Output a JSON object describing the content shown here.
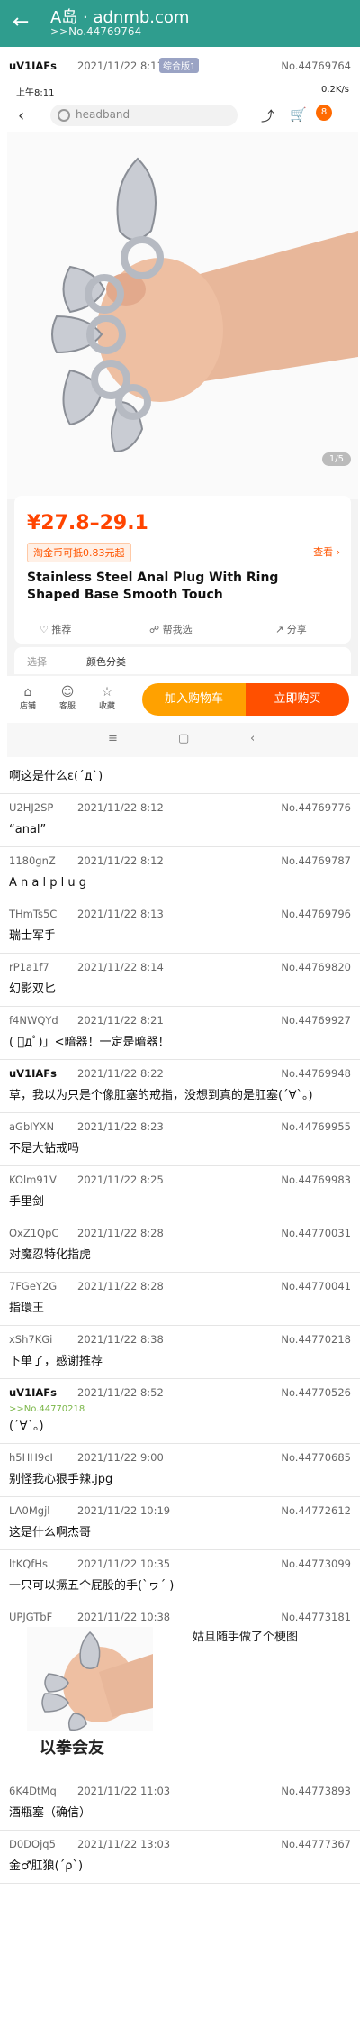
{
  "appbar": {
    "title": "A岛 · adnmb.com",
    "subtitle": ">>No.44769764"
  },
  "op": {
    "uid": "uV1IAFs",
    "time": "2021/11/22 8:11",
    "tag": "综合版1",
    "no": "No.44769764"
  },
  "screenshot": {
    "status_time": "上午8:11",
    "status_right": "0.2K/s",
    "search_placeholder": "headband",
    "cart_badge": "8",
    "pager": "1/5",
    "price": "¥27.8–29.1",
    "coupon": "淘金币可抵0.83元起",
    "view_link": "查看 ›",
    "product_title": "Stainless Steel Anal Plug With Ring Shaped Base Smooth Touch",
    "actions": [
      "推荐",
      "帮我选",
      "分享"
    ],
    "option_row": [
      "选择",
      "颜色分类"
    ],
    "bottom_icons": [
      "店铺",
      "客服",
      "收藏"
    ],
    "add_cart": "加入购物车",
    "buy_now": "立即购买",
    "sys_nav": [
      "≡",
      "▢",
      "‹"
    ]
  },
  "replies": [
    {
      "uid": "",
      "time": "",
      "no": "",
      "content": "啊这是什么ε(´д`)"
    },
    {
      "uid": "U2HJ2SP",
      "time": "2021/11/22 8:12",
      "no": "No.44769776",
      "content": "“anal”"
    },
    {
      "uid": "1180gnZ",
      "time": "2021/11/22 8:12",
      "no": "No.44769787",
      "content": "A n a l p l u g"
    },
    {
      "uid": "THmTs5C",
      "time": "2021/11/22 8:13",
      "no": "No.44769796",
      "content": "瑞士军手"
    },
    {
      "uid": "rP1a1f7",
      "time": "2021/11/22 8:14",
      "no": "No.44769820",
      "content": "幻影双匕"
    },
    {
      "uid": "f4NWQYd",
      "time": "2021/11/22 8:21",
      "no": "No.44769927",
      "content": "( ﾟдﾟ)」<暗器！一定是暗器！"
    },
    {
      "uid": "uV1IAFs",
      "time": "2021/11/22 8:22",
      "no": "No.44769948",
      "content": "草，我以为只是个像肛塞的戒指，没想到真的是肛塞(´∀`。)",
      "po": true
    },
    {
      "uid": "aGbIYXN",
      "time": "2021/11/22 8:23",
      "no": "No.44769955",
      "content": "不是大钻戒吗"
    },
    {
      "uid": "KOlm91V",
      "time": "2021/11/22 8:25",
      "no": "No.44769983",
      "content": "手里剑"
    },
    {
      "uid": "OxZ1QpC",
      "time": "2021/11/22 8:28",
      "no": "No.44770031",
      "content": "对魔忍特化指虎"
    },
    {
      "uid": "7FGeY2G",
      "time": "2021/11/22 8:28",
      "no": "No.44770041",
      "content": "指環王"
    },
    {
      "uid": "xSh7KGi",
      "time": "2021/11/22 8:38",
      "no": "No.44770218",
      "content": "下单了，感谢推荐"
    },
    {
      "uid": "uV1IAFs",
      "time": "2021/11/22 8:52",
      "no": "No.44770526",
      "quote": ">>No.44770218",
      "content": "(´∀`。)",
      "po": true
    },
    {
      "uid": "h5HH9cI",
      "time": "2021/11/22 9:00",
      "no": "No.44770685",
      "content": "别怪我心狠手辣.jpg"
    },
    {
      "uid": "LA0Mgjl",
      "time": "2021/11/22 10:19",
      "no": "No.44772612",
      "content": "这是什么啊杰哥"
    },
    {
      "uid": "ltKQfHs",
      "time": "2021/11/22 10:35",
      "no": "No.44773099",
      "content": "一只可以撅五个屁股的手(`ヮ´ )"
    },
    {
      "uid": "UPJGTbF",
      "time": "2021/11/22 10:38",
      "no": "No.44773181",
      "content": "",
      "meme": {
        "caption": "姑且随手做了个梗图",
        "text": "以拳会友"
      }
    },
    {
      "uid": "6K4DtMq",
      "time": "2021/11/22 11:03",
      "no": "No.44773893",
      "content": "酒瓶塞（确信）"
    },
    {
      "uid": "D0DOjq5",
      "time": "2021/11/22 13:03",
      "no": "No.44777367",
      "content": "金♂肛狼(´ρ`)"
    }
  ]
}
